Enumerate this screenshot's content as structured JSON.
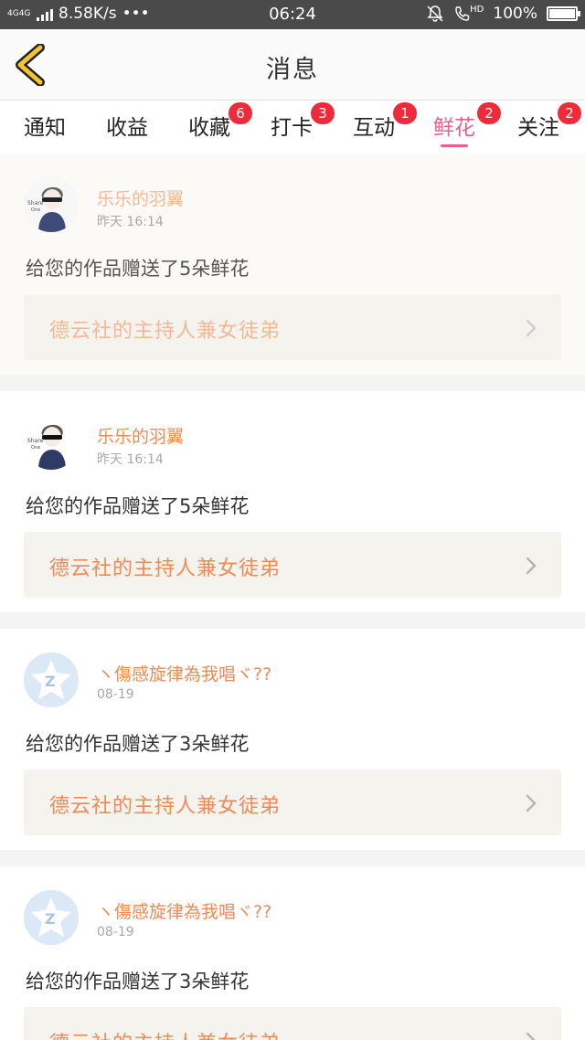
{
  "status_bar": {
    "network": "4G4G",
    "speed": "8.58K/s",
    "more": "•••",
    "time": "06:24",
    "hd": "HD",
    "battery": "100%"
  },
  "header": {
    "back_icon": "chevron-left-icon",
    "title": "消息",
    "accent_color": "#f4c430"
  },
  "tabs": [
    {
      "label": "通知",
      "badge": ""
    },
    {
      "label": "收益",
      "badge": ""
    },
    {
      "label": "收藏",
      "badge": "6"
    },
    {
      "label": "打卡",
      "badge": "3"
    },
    {
      "label": "互动",
      "badge": "1"
    },
    {
      "label": "鲜花",
      "badge": "2",
      "active": true
    },
    {
      "label": "关注",
      "badge": "2"
    }
  ],
  "colors": {
    "active_tab": "#e8608a",
    "badge": "#ef2a3a",
    "name": "#f08a56",
    "work_bg": "#f4f3ee"
  },
  "messages": [
    {
      "avatar": "cartoon-boy-avatar",
      "name": "乐乐的羽翼",
      "time": "昨天 16:14",
      "text": "给您的作品赠送了5朵鲜花",
      "work": "德云社的主持人兼女徒弟"
    },
    {
      "avatar": "cartoon-boy-avatar",
      "name": "乐乐的羽翼",
      "time": "昨天 16:14",
      "text": "给您的作品赠送了5朵鲜花",
      "work": "德云社的主持人兼女徒弟"
    },
    {
      "avatar": "qq-default-avatar",
      "name": "ヽ傷感旋律為我唱ヾ??",
      "time": "08-19",
      "text": "给您的作品赠送了3朵鲜花",
      "work": "德云社的主持人兼女徒弟"
    },
    {
      "avatar": "qq-default-avatar",
      "name": "ヽ傷感旋律為我唱ヾ??",
      "time": "08-19",
      "text": "给您的作品赠送了3朵鲜花",
      "work": "德云社的主持人兼女徒弟"
    }
  ]
}
